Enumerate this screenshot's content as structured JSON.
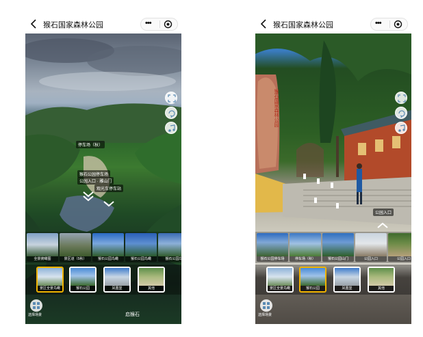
{
  "left": {
    "title": "猴石国家森林公园",
    "capsule": {
      "more": "•••"
    },
    "hotspots": {
      "parking_bus": "停车场（秋）",
      "park_parking": "猴石公园停车场",
      "gate": "公园入口 · 雕山门",
      "station": "观光车停车站"
    },
    "scenes": [
      "全景俯瞰图",
      "景区道（5秋）",
      "猴石公园鸟瞰",
      "猴石公园鸟瞰",
      "猴石公园鸟"
    ],
    "groups": [
      "景区全景鸟瞰",
      "猴石公园",
      "凤凰堡",
      "其他"
    ],
    "active_group": 0,
    "select_label": "选择场景",
    "location": "启猴石"
  },
  "right": {
    "title": "猴石国家森林公园",
    "capsule": {
      "more": "•••"
    },
    "sign_text": "猴石国家森林公园",
    "hotspot": "公园入口",
    "scenes": [
      "猴石公园停车场",
      "停车场（秋）",
      "猴石公园山门",
      "公园入口",
      "公园入口"
    ],
    "groups": [
      "景区全景鸟瞰",
      "猴石公园",
      "凤凰堡",
      "其他"
    ],
    "active_group": 1,
    "select_label": "选择场景"
  },
  "colors": {
    "active_border": "#f0b300",
    "nav_text": "#111111"
  },
  "icons": [
    "back-arrow-icon",
    "more-dots-icon",
    "target-icon",
    "fullscreen-icon",
    "gyroscope-icon",
    "music-icon",
    "grid-icon",
    "chevron-up-icon"
  ]
}
